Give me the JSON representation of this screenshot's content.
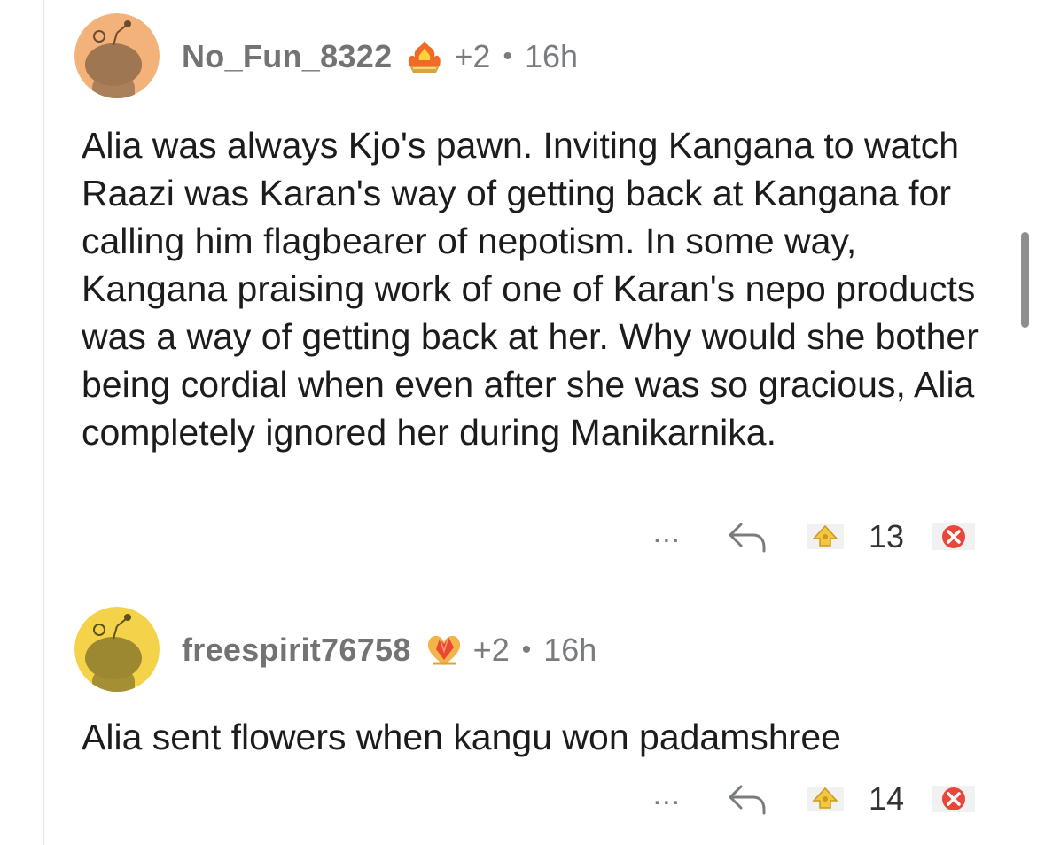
{
  "comments": [
    {
      "username": "No_Fun_8322",
      "avatar_color": "#f2b27a",
      "award_count": "+2",
      "separator": "•",
      "time": "16h",
      "body": "Alia was always Kjo's pawn. Inviting Kangana to watch Raazi was Karan's way of getting back at Kangana for calling him flagbearer of nepotism. In some way, Kangana praising work of one of Karan's nepo products was a way of getting back at her. Why would she bother being cordial when even after she was so gracious, Alia completely ignored her during Manikarnika.",
      "more": "...",
      "score": "13"
    },
    {
      "username": "freespirit76758",
      "avatar_color": "#f4d24a",
      "award_count": "+2",
      "separator": "•",
      "time": "16h",
      "body": "Alia sent flowers when kangu won padamshree",
      "more": "...",
      "score": "14"
    }
  ],
  "icons": {
    "award_1": "fire-award-icon",
    "award_2": "crystal-heart-award-icon",
    "reply": "reply-arrow-icon",
    "upvote": "upvote-icon",
    "downvote": "downvote-icon"
  },
  "colors": {
    "meta_text": "#787c7e",
    "body_text": "#1c1c1c",
    "upvote_accent": "#f5c640",
    "downvote_accent": "#e8473a"
  }
}
